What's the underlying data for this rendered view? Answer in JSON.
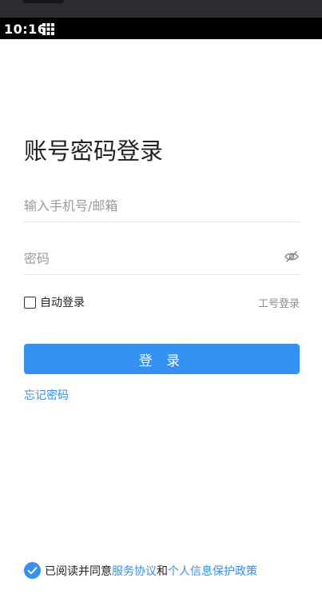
{
  "status_bar": {
    "time": "10:16",
    "icons": [
      "grid-icon"
    ]
  },
  "login": {
    "title": "账号密码登录",
    "account_placeholder": "输入手机号/邮箱",
    "password_placeholder": "密码",
    "auto_login_label": "自动登录",
    "auto_login_checked": false,
    "employee_login": "工号登录",
    "login_button": "登 录",
    "forgot_password": "忘记密码"
  },
  "agreement": {
    "checked": true,
    "prefix": "已阅读并同意",
    "service_link": "服务协议",
    "conjunction": "和",
    "privacy_link": "个人信息保护政策"
  },
  "colors": {
    "accent": "#3590f3",
    "status_bar_bg": "#000000",
    "text_primary": "#222222",
    "text_hint": "#9a9a9a"
  }
}
